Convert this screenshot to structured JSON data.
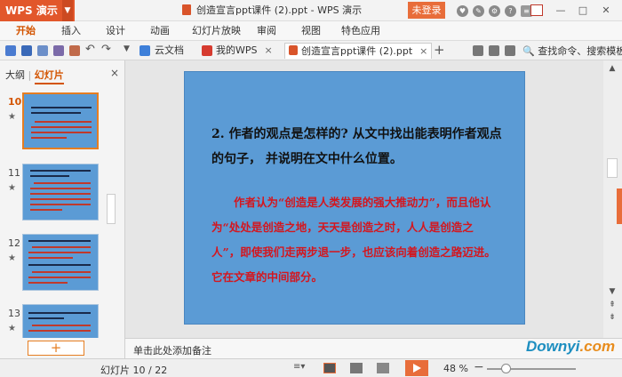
{
  "app": {
    "logo": "WPS 演示",
    "title": "创造宣言ppt课件 (2).ppt - WPS 演示",
    "login": "未登录"
  },
  "ribbon": {
    "tabs": [
      "开始",
      "插入",
      "设计",
      "动画",
      "幻灯片放映",
      "审阅",
      "视图",
      "特色应用"
    ]
  },
  "doctabs": [
    {
      "label": "云文档"
    },
    {
      "label": "我的WPS",
      "close": "×"
    },
    {
      "label": "创造宣言ppt课件 (2).ppt",
      "close": "×"
    }
  ],
  "search": {
    "label": "查找命令、搜索模板"
  },
  "panel": {
    "tab_outline": "大纲",
    "tab_slides": "幻灯片",
    "close": "×"
  },
  "thumbnails": [
    {
      "num": "10",
      "star": "★"
    },
    {
      "num": "11",
      "star": "★"
    },
    {
      "num": "12",
      "star": "★"
    },
    {
      "num": "13",
      "star": "★"
    }
  ],
  "addslide": "+",
  "slide": {
    "question": "2. 作者的观点是怎样的? 从文中找出能表明作者观点的句子， 并说明在文中什么位置。",
    "answer": "作者认为“创造是人类发展的强大推动力”，而且他认为“处处是创造之地，天天是创造之时，人人是创造之人”，即使我们走两步退一步，也应该向着创造之路迈进。它在文章的中间部分。"
  },
  "notes": "单击此处添加备注",
  "status": {
    "slide_count": "幻灯片 10 / 22",
    "zoom": "48 %"
  },
  "watermark": {
    "a": "Downyi",
    "b": ".com"
  },
  "colors": {
    "accent": "#e86d3a",
    "slide_bg": "#5b9bd5",
    "answer_red": "#d4161e"
  }
}
